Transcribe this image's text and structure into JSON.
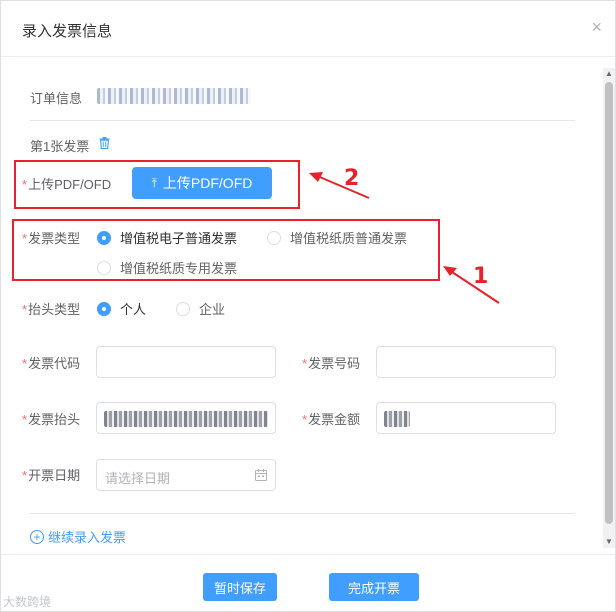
{
  "dialog": {
    "title": "录入发票信息",
    "close_icon": "×"
  },
  "order": {
    "label": "订单信息"
  },
  "invoice_section": {
    "title": "第1张发票"
  },
  "upload": {
    "label": "上传PDF/OFD",
    "button_label": "上传PDF/OFD",
    "button_icon": "upload-icon"
  },
  "invoice_type": {
    "label": "发票类型",
    "options": [
      "增值税电子普通发票",
      "增值税纸质普通发票",
      "增值税纸质专用发票"
    ],
    "selected": "增值税电子普通发票"
  },
  "title_type": {
    "label": "抬头类型",
    "options": [
      "个人",
      "企业"
    ],
    "selected": "个人"
  },
  "fields": {
    "code_label": "发票代码",
    "code_value": "",
    "number_label": "发票号码",
    "number_value": "",
    "header_label": "发票抬头",
    "amount_label": "发票金额",
    "date_label": "开票日期",
    "date_placeholder": "请选择日期"
  },
  "add_more": {
    "label": "继续录入发票"
  },
  "footer": {
    "save_label": "暂时保存",
    "submit_label": "完成开票",
    "watermark": "大数跨境"
  },
  "annotations": {
    "marker_1": "1",
    "marker_2": "2",
    "color": "#e8212b"
  },
  "colors": {
    "primary": "#409eff",
    "required": "#f56c6c"
  }
}
